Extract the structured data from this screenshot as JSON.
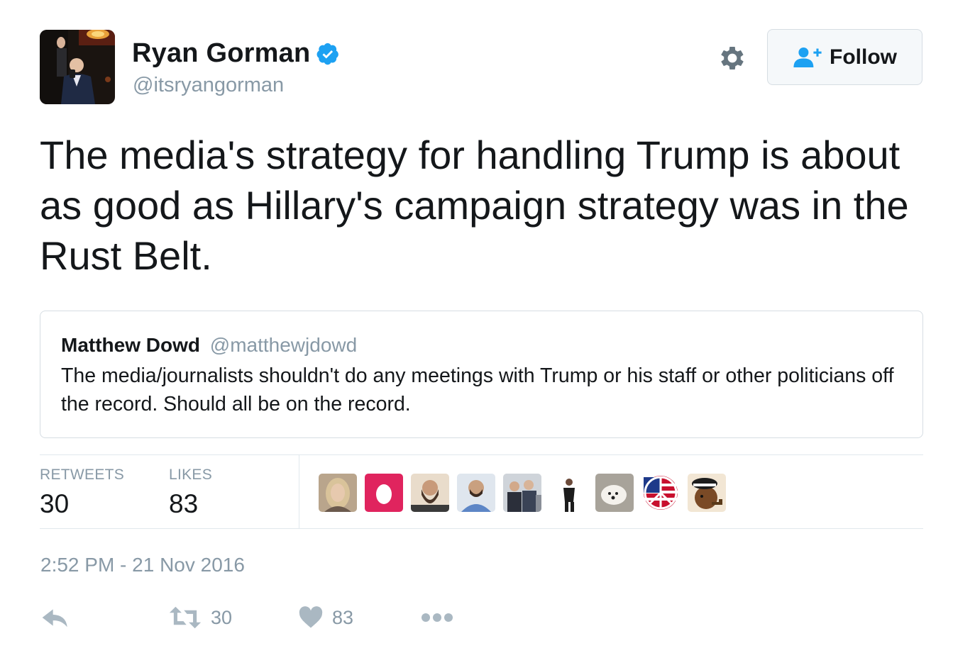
{
  "author": {
    "display_name": "Ryan Gorman",
    "handle": "@itsryangorman",
    "verified": true,
    "avatar_icon": "profile-photo-singer-on-stage"
  },
  "header": {
    "gear_icon": "gear-icon",
    "follow_label": "Follow",
    "follow_icon": "follow-user-icon"
  },
  "tweet": {
    "text": "The media's strategy for handling Trump is about as good as Hillary's campaign strategy was in the Rust Belt."
  },
  "quoted_tweet": {
    "display_name": "Matthew Dowd",
    "handle": "@matthewjdowd",
    "text": "The media/journalists shouldn't do any meetings with Trump or his staff or other politicians off the record.  Should all be on the record."
  },
  "stats": {
    "retweets_label": "RETWEETS",
    "retweets_value": "30",
    "likes_label": "LIKES",
    "likes_value": "83",
    "likers": [
      {
        "icon": "avatar-woman-portrait"
      },
      {
        "icon": "avatar-default-egg"
      },
      {
        "icon": "avatar-bearded-man"
      },
      {
        "icon": "avatar-man-blue-shirt"
      },
      {
        "icon": "avatar-group-photo"
      },
      {
        "icon": "avatar-man-standing"
      },
      {
        "icon": "avatar-white-dog"
      },
      {
        "icon": "avatar-peace-sign-flag"
      },
      {
        "icon": "avatar-dog-captain-hat"
      }
    ]
  },
  "timestamp": "2:52 PM - 21 Nov 2016",
  "actions": {
    "reply_icon": "reply-icon",
    "retweet_icon": "retweet-icon",
    "retweet_count": "30",
    "like_icon": "heart-icon",
    "like_count": "83",
    "more_icon": "more-dots-icon"
  },
  "colors": {
    "text": "#14171a",
    "muted": "#8899a6",
    "border": "#e1e8ed",
    "verified_blue": "#1da1f2",
    "icon_gray": "#aab8c2"
  }
}
